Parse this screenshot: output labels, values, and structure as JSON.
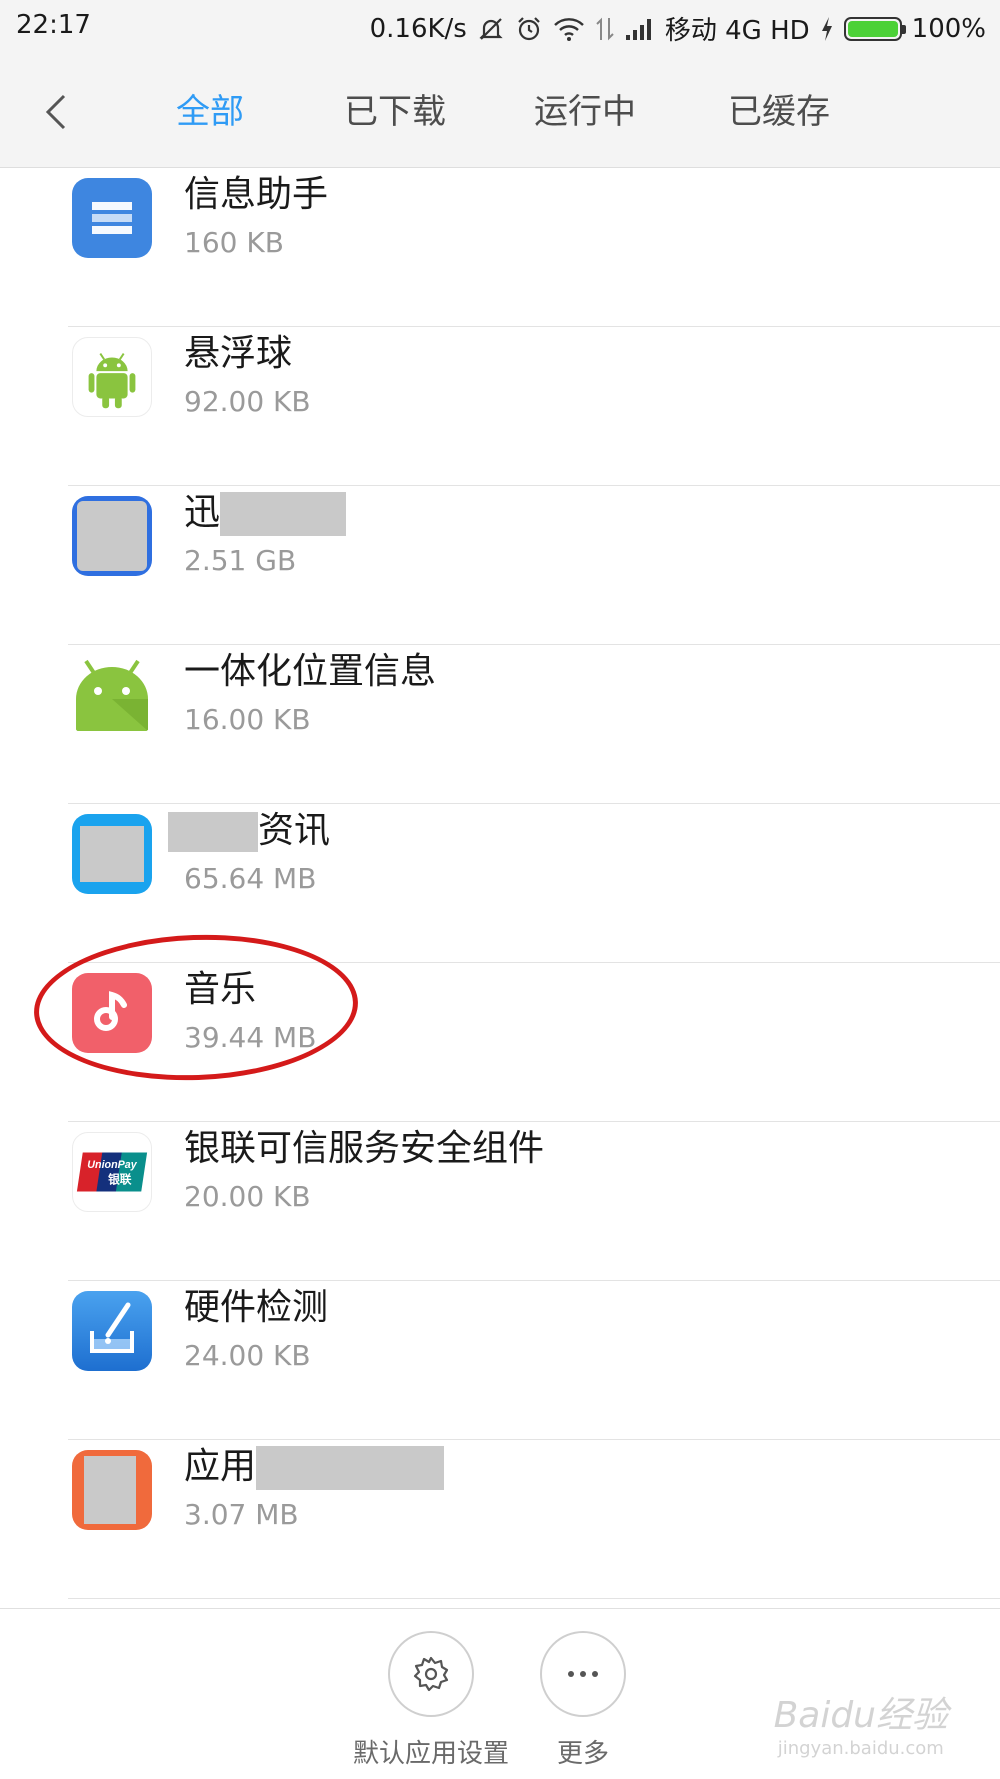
{
  "status_bar": {
    "time": "22:17",
    "net_speed": "0.16K/s",
    "carrier": "移动 4G HD",
    "battery_text": "100%",
    "battery_level": 1.0,
    "icons": [
      "mute-icon",
      "alarm-icon",
      "wifi-icon",
      "data-arrows-icon",
      "signal-icon",
      "charging-icon",
      "battery-icon"
    ]
  },
  "header": {
    "back_icon": "chevron-left-icon",
    "tabs": [
      {
        "label": "全部",
        "active": true
      },
      {
        "label": "已下载",
        "active": false
      },
      {
        "label": "运行中",
        "active": false
      },
      {
        "label": "已缓存",
        "active": false
      }
    ],
    "accent_color": "#2f9bf5"
  },
  "apps": [
    {
      "name": "信息助手",
      "size": "160 KB",
      "icon": "message-assistant-icon"
    },
    {
      "name": "悬浮球",
      "size": "92.00 KB",
      "icon": "android-robot-icon"
    },
    {
      "name": "迅",
      "size": "2.51 GB",
      "icon": "redacted-app-icon"
    },
    {
      "name": "一体化位置信息",
      "size": "16.00 KB",
      "icon": "android-head-icon"
    },
    {
      "name": "资讯",
      "size": "65.64 MB",
      "icon": "redacted-app-icon"
    },
    {
      "name": "音乐",
      "size": "39.44 MB",
      "icon": "music-note-icon"
    },
    {
      "name": "银联可信服务安全组件",
      "size": "20.00 KB",
      "icon": "unionpay-icon"
    },
    {
      "name": "硬件检测",
      "size": "24.00 KB",
      "icon": "hardware-test-icon"
    },
    {
      "name": "应用",
      "size": "3.07 MB",
      "icon": "redacted-app-icon"
    }
  ],
  "unionpay_logo_text": "UnionPay",
  "unionpay_logo_cn": "银联",
  "highlight_color": "#d41a1a",
  "bottom_bar": {
    "default_apps_label": "默认应用设置",
    "more_label": "更多"
  },
  "watermark": {
    "brand": "Baidu经验",
    "url": "jingyan.baidu.com"
  }
}
